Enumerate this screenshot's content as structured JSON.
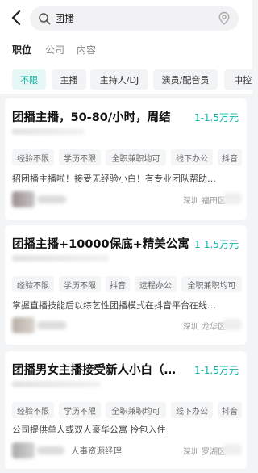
{
  "search": {
    "query": "团播"
  },
  "tabs": [
    {
      "label": "职位"
    },
    {
      "label": "公司"
    },
    {
      "label": "内容"
    }
  ],
  "filters": [
    "不限",
    "主播",
    "主持人/DJ",
    "演员/配音员",
    "中控/"
  ],
  "jobs": [
    {
      "title": "团播主播，50-80/小时，周结",
      "salary": "1-1.5万元",
      "tags": [
        "经验不限",
        "学历不限",
        "全职兼职均可",
        "线下办公",
        "抖音"
      ],
      "description": "招团播主播啦！接受无经验小白！有专业团队帮助…",
      "recruiter": "",
      "location": "深圳  福田区"
    },
    {
      "title": "团播主播+10000保底+精美公寓",
      "salary": "1-1.5万元",
      "tags": [
        "经验不限",
        "学历不限",
        "抖音",
        "远程办公",
        "全职兼职均可"
      ],
      "description": "掌握直播技能后以综艺性团播模式在抖音平台在线…",
      "recruiter": "",
      "location": "深圳  龙华区"
    },
    {
      "title": "团播男女主播接受新人小白（…",
      "salary": "1-1.5万元",
      "tags": [
        "经验不限",
        "学历不限",
        "全职兼职均可",
        "线下办公",
        "抖音"
      ],
      "description": "公司提供单人或双人豪华公寓 拎包入住",
      "recruiter": "人事资源经理",
      "location": "深圳  罗湖区"
    }
  ]
}
